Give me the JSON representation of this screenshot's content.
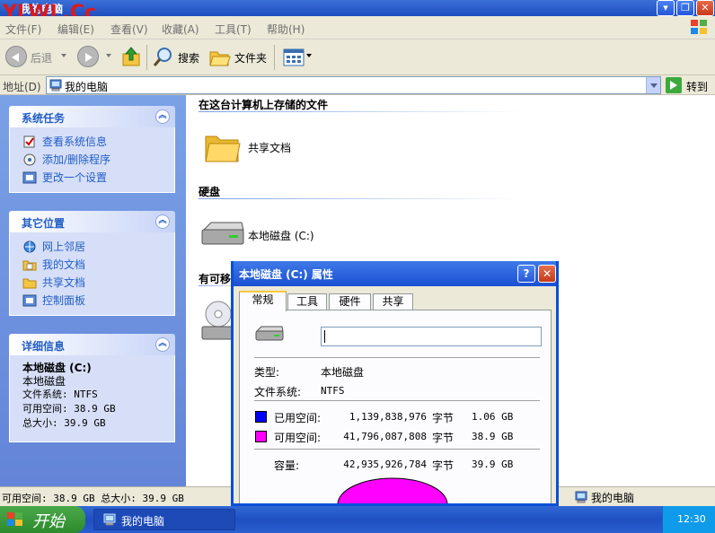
{
  "window": {
    "title": "我的电脑",
    "watermark": "YLWL.Cc",
    "min_glyph": "▾",
    "max_glyph": "❐",
    "close_glyph": "✕"
  },
  "menu": [
    "文件(F)",
    "编辑(E)",
    "查看(V)",
    "收藏(A)",
    "工具(T)",
    "帮助(H)"
  ],
  "toolbar": {
    "back": "后退",
    "search": "搜索",
    "folders": "文件夹"
  },
  "address": {
    "label": "地址(D)",
    "value": "我的电脑",
    "go": "转到"
  },
  "sidebar": {
    "system_tasks": {
      "title": "系统任务",
      "items": [
        "查看系统信息",
        "添加/删除程序",
        "更改一个设置"
      ]
    },
    "other_places": {
      "title": "其它位置",
      "items": [
        "网上邻居",
        "我的文档",
        "共享文档",
        "控制面板"
      ]
    },
    "details": {
      "title": "详细信息",
      "name": "本地磁盘 (C:)",
      "type": "本地磁盘",
      "fs": "文件系统: NTFS",
      "free": "可用空间: 38.9 GB",
      "total": "总大小: 39.9 GB"
    },
    "collapse_glyph": "︽"
  },
  "content": {
    "stored_header": "在这台计算机上存储的文件",
    "shared_docs": "共享文档",
    "hard_disks_header": "硬盘",
    "local_disk": "本地磁盘 (C:)",
    "removable_header": "有可移"
  },
  "status": {
    "left": "可用空间: 38.9 GB 总大小: 39.9 GB",
    "right": "我的电脑"
  },
  "taskbar": {
    "start": "开始",
    "task": "我的电脑",
    "clock": "12:30"
  },
  "dialog": {
    "title": "本地磁盘 (C:) 属性",
    "help_glyph": "?",
    "close_glyph": "✕",
    "tabs": [
      "常规",
      "工具",
      "硬件",
      "共享"
    ],
    "type_label": "类型:",
    "type_value": "本地磁盘",
    "fs_label": "文件系统:",
    "fs_value": "NTFS",
    "used_label": "已用空间:",
    "used_bytes": "1,139,838,976",
    "used_unit": "字节",
    "used_gb": "1.06 GB",
    "free_label": "可用空间:",
    "free_bytes": "41,796,087,808",
    "free_unit": "字节",
    "free_gb": "38.9 GB",
    "cap_label": "容量:",
    "cap_bytes": "42,935,926,784",
    "cap_unit": "字节",
    "cap_gb": "39.9 GB",
    "colors": {
      "used": "#0000ff",
      "free": "#ff00ff"
    }
  }
}
